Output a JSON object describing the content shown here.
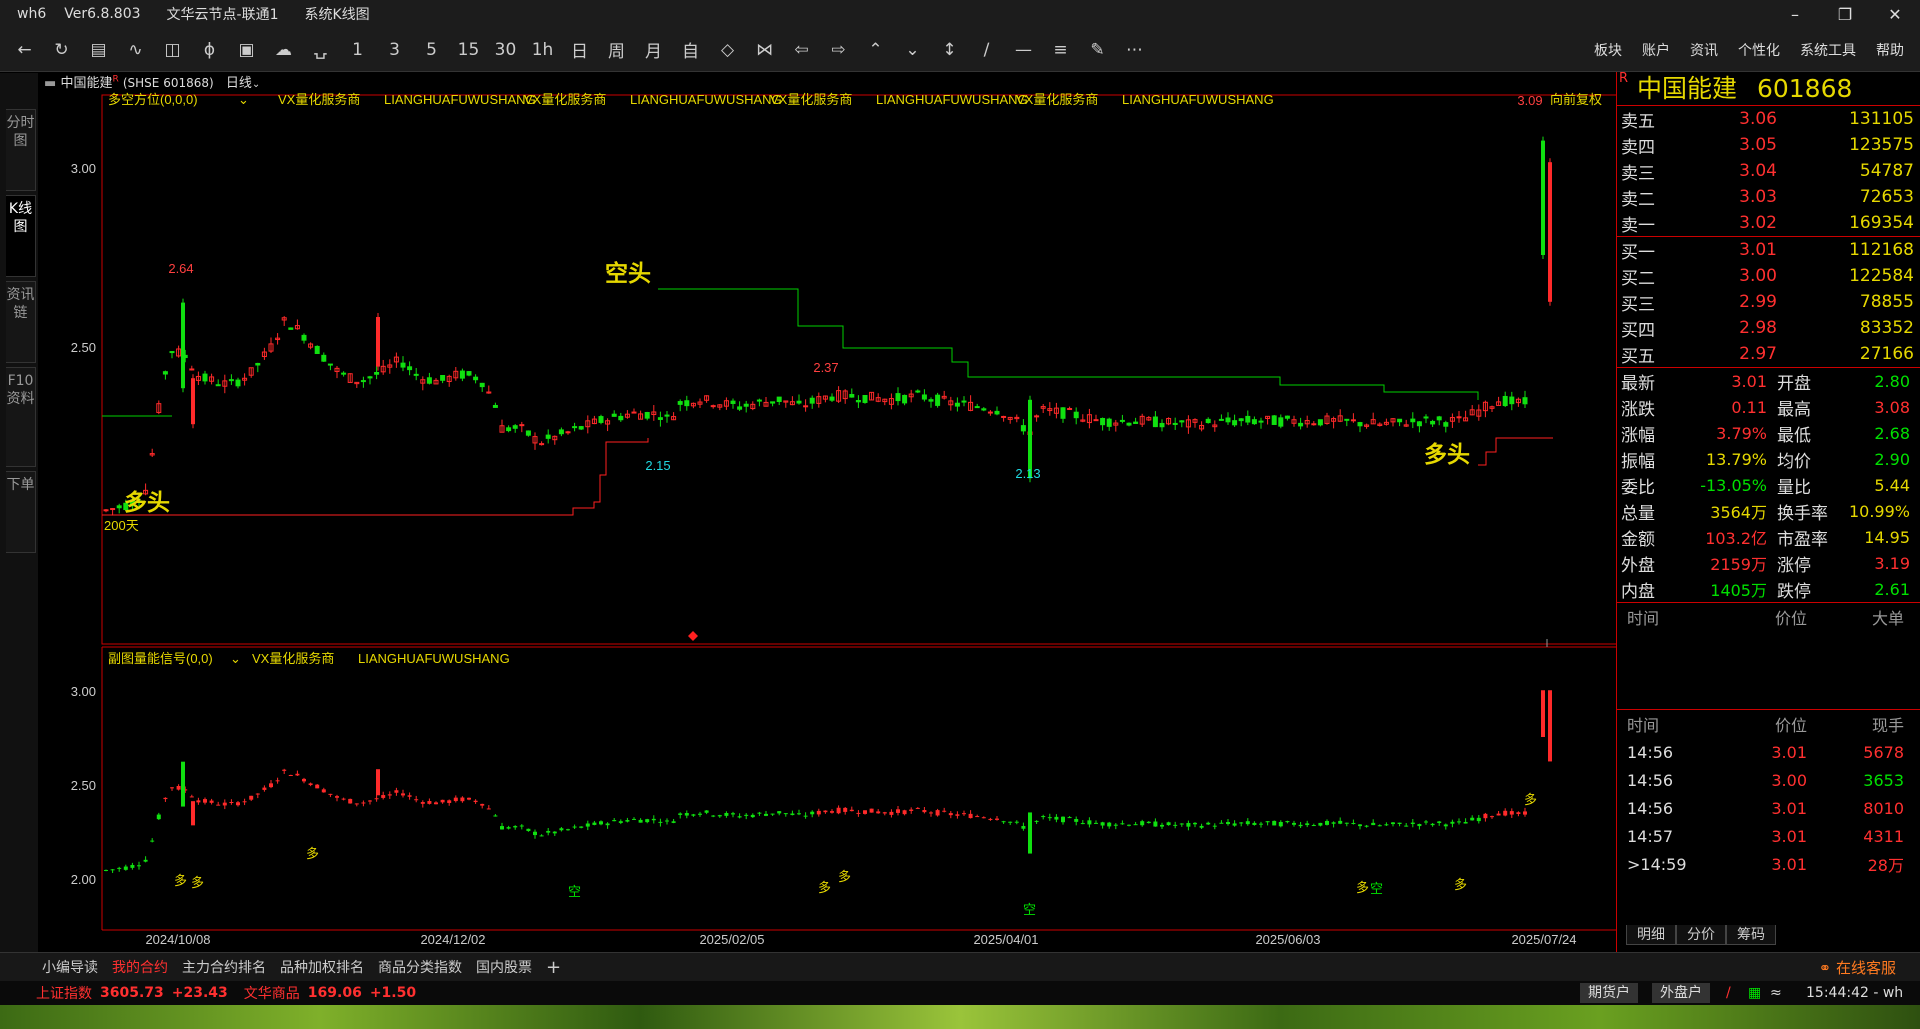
{
  "window": {
    "app": "wh6",
    "version": "Ver6.8.803",
    "node": "文华云节点-联通1",
    "view": "系统K线图"
  },
  "toolbar": {
    "periods": [
      "1",
      "3",
      "5",
      "15",
      "30",
      "1h",
      "日",
      "周",
      "月",
      "自"
    ],
    "menus": [
      "板块",
      "账户",
      "资讯",
      "个性化",
      "系统工具",
      "帮助"
    ]
  },
  "left_tabs": [
    "分时图",
    "K线图",
    "资讯链",
    "F10资料",
    "下单"
  ],
  "chart_header": {
    "name": "中国能建",
    "sup": "R",
    "code": "(SHSE 601868)",
    "period": "日线"
  },
  "main_indicator": {
    "name": "多空方位(0,0,0)",
    "labels": [
      "VX量化服务商",
      "LIANGHUAFUWUSHANG",
      "VX量化服务商",
      "LIANGHUAFUWUSHANG",
      "VX量化服务商",
      "LIANGHUAFUWUSHANG",
      "VX量化服务商",
      "LIANGHUAFUWUSHANG"
    ],
    "adjust": "向前复权"
  },
  "sub_indicator": {
    "name": "副图量能信号(0,0)",
    "labels": [
      "VX量化服务商",
      "LIANGHUAFUWUSHANG"
    ]
  },
  "chart_data": {
    "type": "candlestick",
    "main_y_ticks": [
      "3.00",
      "2.50"
    ],
    "sub_y_ticks": [
      "3.00",
      "2.50",
      "2.00"
    ],
    "x_ticks": [
      "2024/10/08",
      "2024/12/02",
      "2025/02/05",
      "2025/04/01",
      "2025/06/03",
      "2025/07/24"
    ],
    "annotations": {
      "high1": "2.64",
      "high2": "2.37",
      "low1": "2.15",
      "low2": "2.13",
      "last_high": "3.09",
      "bear": "空头",
      "bull": "多头",
      "bull2": "多头",
      "days": "200天",
      "sub_signals": [
        "多",
        "多",
        "多",
        "空",
        "多",
        "多",
        "空",
        "多",
        "空",
        "多",
        "多"
      ]
    }
  },
  "quote": {
    "name": "中国能建",
    "code": "601868",
    "flag": "R",
    "asks": [
      {
        "label": "卖五",
        "price": "3.06",
        "vol": "131105"
      },
      {
        "label": "卖四",
        "price": "3.05",
        "vol": "123575"
      },
      {
        "label": "卖三",
        "price": "3.04",
        "vol": "54787"
      },
      {
        "label": "卖二",
        "price": "3.03",
        "vol": "72653"
      },
      {
        "label": "卖一",
        "price": "3.02",
        "vol": "169354"
      }
    ],
    "bids": [
      {
        "label": "买一",
        "price": "3.01",
        "vol": "112168"
      },
      {
        "label": "买二",
        "price": "3.00",
        "vol": "122584"
      },
      {
        "label": "买三",
        "price": "2.99",
        "vol": "78855"
      },
      {
        "label": "买四",
        "price": "2.98",
        "vol": "83352"
      },
      {
        "label": "买五",
        "price": "2.97",
        "vol": "27166"
      }
    ],
    "stats": [
      [
        "最新",
        "3.01",
        "开盘",
        "2.80"
      ],
      [
        "涨跌",
        "0.11",
        "最高",
        "3.08"
      ],
      [
        "涨幅",
        "3.79%",
        "最低",
        "2.68"
      ],
      [
        "振幅",
        "13.79%",
        "均价",
        "2.90"
      ],
      [
        "委比",
        "-13.05%",
        "量比",
        "5.44"
      ],
      [
        "总量",
        "3564万",
        "换手率",
        "10.99%"
      ],
      [
        "金额",
        "103.2亿",
        "市盈率",
        "14.95"
      ],
      [
        "外盘",
        "2159万",
        "涨停",
        "3.19"
      ],
      [
        "内盘",
        "1405万",
        "跌停",
        "2.61"
      ]
    ],
    "big_header": [
      "时间",
      "价位",
      "大单"
    ],
    "tick_header": [
      "时间",
      "价位",
      "现手"
    ],
    "ticks": [
      {
        "time": "14:56",
        "price": "3.01",
        "vol": "5678",
        "color": "#ff3030"
      },
      {
        "time": "14:56",
        "price": "3.00",
        "vol": "3653",
        "color": "#00e000"
      },
      {
        "time": "14:56",
        "price": "3.01",
        "vol": "8010",
        "color": "#ff3030"
      },
      {
        "time": "14:57",
        "price": "3.01",
        "vol": "4311",
        "color": "#ff3030"
      },
      {
        "time": ">14:59",
        "price": "3.01",
        "vol": "28万",
        "color": "#ff3030"
      }
    ],
    "tabs": [
      "明细",
      "分价",
      "筹码"
    ]
  },
  "bottom_tabs": [
    "小编导读",
    "我的合约",
    "主力合约排名",
    "品种加权排名",
    "商品分类指数",
    "国内股票"
  ],
  "status": {
    "index1_name": "上证指数",
    "index1_val": "3605.73",
    "index1_chg": "+23.43",
    "index2_name": "文华商品",
    "index2_val": "169.06",
    "index2_chg": "+1.50",
    "service": "在线客服",
    "futures": "期货户",
    "outer": "外盘户",
    "time": "15:44:42 - wh"
  },
  "colors": {
    "up": "#ff3030",
    "down": "#00e000",
    "label": "#e6d800",
    "bg": "#000000"
  }
}
